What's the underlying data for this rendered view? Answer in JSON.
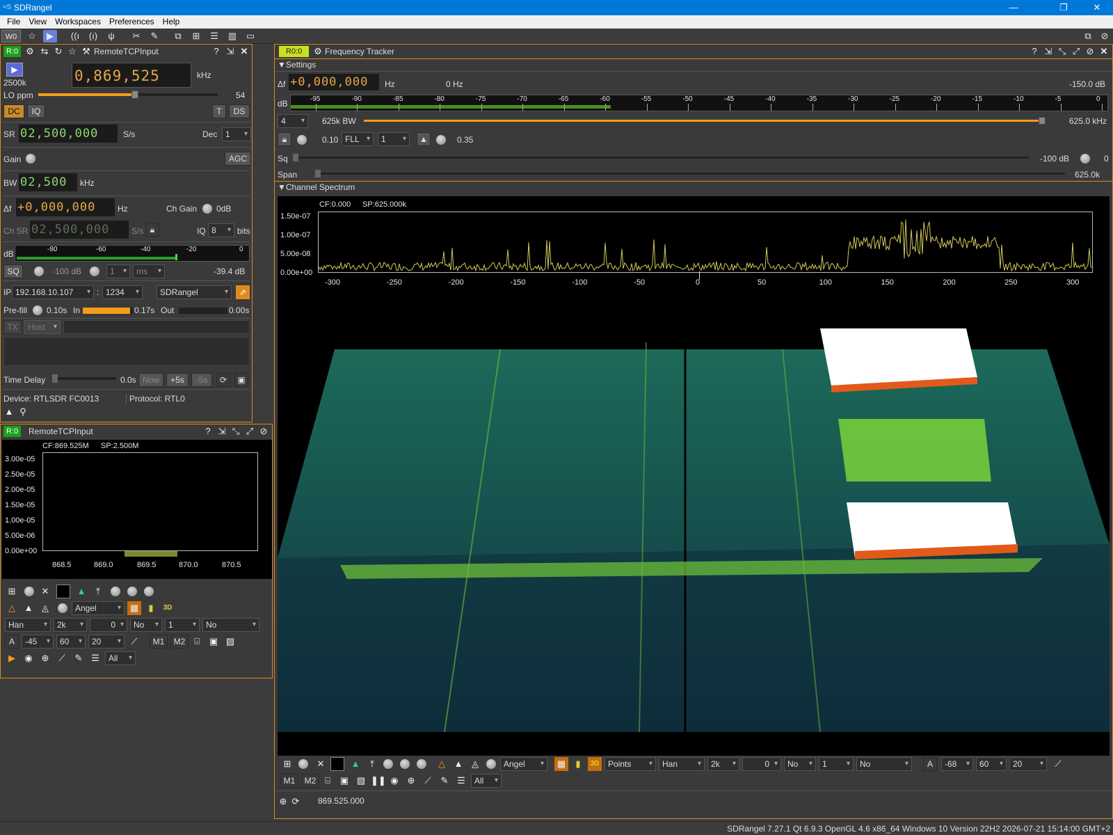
{
  "window": {
    "title": "SDRangel"
  },
  "menu": [
    "File",
    "View",
    "Workspaces",
    "Preferences",
    "Help"
  ],
  "toolbar": {
    "workspace": "W0"
  },
  "device": {
    "badge": "R:0",
    "title": "RemoteTCPInput",
    "sample_rate_label": "2500k",
    "center_freq": "0,869,525",
    "freq_unit": "kHz",
    "lo_ppm_label": "LO ppm",
    "lo_ppm_value": "54",
    "lo_ppm_fraction": 0.54,
    "dc": "DC",
    "iq": "IQ",
    "t": "T",
    "ds": "DS",
    "sr_label": "SR",
    "sr_value": "02,500,000",
    "sr_unit": "S/s",
    "dec_label": "Dec",
    "dec_value": "1",
    "gain_label": "Gain",
    "agc": "AGC",
    "bw_label": "BW",
    "bw_value": "02,500",
    "bw_unit": "kHz",
    "df_label": "Δf",
    "df_value": "+0,000,000",
    "df_unit": "Hz",
    "chgain_label": "Ch Gain",
    "chgain_value": "0dB",
    "chsr_label": "Ch SR",
    "chsr_value": "02,500,000",
    "chsr_unit": "S/s",
    "iq_label": "IQ",
    "iq_value": "8",
    "iq_unit": "bits",
    "db_label": "dB",
    "db_ticks": [
      "-80",
      "-60",
      "-40",
      "-20",
      "0"
    ],
    "sq": "SQ",
    "sq_db": "-100 dB",
    "sq_delay": "1",
    "sq_unit": "ms",
    "level": "-39.4 dB",
    "ip_label": "IP",
    "ip": "192.168.10.107",
    "port_sep": ":",
    "port": "1234",
    "protocol_sel": "SDRangel",
    "prefill_label": "Pre-fill",
    "prefill_value": "0.10s",
    "in_label": "In",
    "in_value": "0.17s",
    "in_fraction": 0.95,
    "out_label": "Out",
    "out_value": "0.00s",
    "out_fraction": 0.0,
    "tx": "TX",
    "host": "Host",
    "time_delay_label": "Time Delay",
    "time_delay_value": "0.0s",
    "now": "Now",
    "plus5": "+5s",
    "minus5": "-5s",
    "status_device": "Device: RTLSDR FC0013",
    "status_protocol": "Protocol: RTL0"
  },
  "spectrum": {
    "badge": "R:0",
    "title": "RemoteTCPInput",
    "cf": "CF:869.525M",
    "sp": "SP:2.500M",
    "y_ticks": [
      "3.00e-05",
      "2.50e-05",
      "2.00e-05",
      "1.50e-05",
      "1.00e-05",
      "5.00e-06",
      "0.00e+00"
    ],
    "x_ticks": [
      "868.5",
      "869.0",
      "869.5",
      "870.0",
      "870.5"
    ],
    "waterfall_mode": "Angel",
    "window": "Han",
    "fft": "2k",
    "overlap": "0",
    "avg_mode": "No",
    "avg": "1",
    "marker": "No",
    "a": "A",
    "ref": "-45",
    "range": "60",
    "rate": "20",
    "m1": "M1",
    "m2": "M2",
    "all": "All"
  },
  "channel": {
    "badge": "R0:0",
    "title": "Frequency Tracker",
    "settings_label": "Settings",
    "df_label": "Δf",
    "df_value": "+0,000,000",
    "df_unit": "Hz",
    "offset_hz": "0 Hz",
    "level": "-150.0  dB",
    "db_label": "dB",
    "db_ticks": [
      "-95",
      "-90",
      "-85",
      "-80",
      "-75",
      "-70",
      "-65",
      "-60",
      "-55",
      "-50",
      "-45",
      "-40",
      "-35",
      "-30",
      "-25",
      "-20",
      "-15",
      "-10",
      "-5",
      "0"
    ],
    "decim": "4",
    "bw_label": "625k BW",
    "bw_value": "625.0 kHz",
    "bw_fraction": 1.0,
    "alpha": "0.10",
    "mode": "FLL",
    "order": "1",
    "damping": "0.35",
    "sq_label": "Sq",
    "sq_value": "-100 dB",
    "sq_gate": "0",
    "span_label": "Span",
    "span_value": "625.0k",
    "channel_spectrum_label": "Channel Spectrum",
    "cf": "CF:0.000",
    "sp": "SP:625.000k",
    "y_ticks": [
      "1.50e-07",
      "1.00e-07",
      "5.00e-08",
      "0.00e+00"
    ],
    "x_ticks": [
      "-300",
      "-250",
      "-200",
      "-150",
      "-100",
      "-50",
      "0",
      "50",
      "100",
      "150",
      "200",
      "250",
      "300"
    ],
    "waterfall_mode": "Angel",
    "points": "Points",
    "window": "Han",
    "fft": "2k",
    "overlap": "0",
    "avg_mode": "No",
    "avg": "1",
    "marker": "No",
    "a": "A",
    "ref": "-68",
    "range": "60",
    "rate": "20",
    "m1": "M1",
    "m2": "M2",
    "all": "All",
    "status_freq": "869.525.000"
  },
  "statusbar": "SDRangel 7.27.1 Qt 6.9.3 OpenGL 4.6 x86_64 Windows 10 Version 22H2  2026-07-21 15:14:00 GMT+2",
  "colors": {
    "accent": "#e08a1e",
    "lcd_digits": "#f0b040",
    "lcd_green": "#8fd86f",
    "trace": "#d4c95a"
  }
}
